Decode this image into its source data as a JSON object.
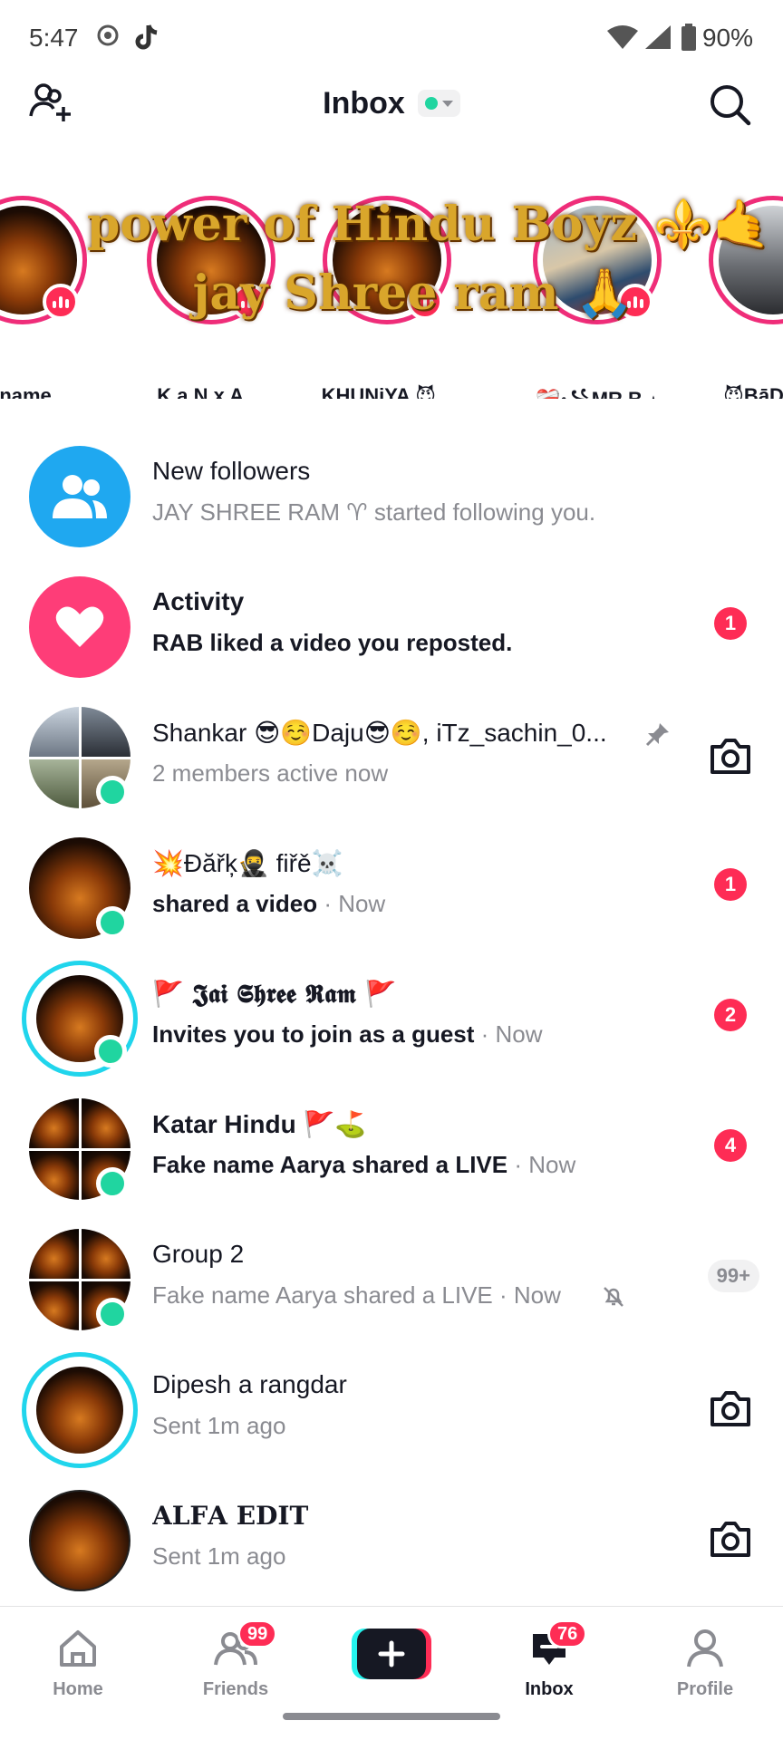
{
  "status_bar": {
    "time": "5:47",
    "battery": "90%"
  },
  "header": {
    "title": "Inbox"
  },
  "stories": [
    {
      "name": "ke name ..."
    },
    {
      "name": "K a N x A ..."
    },
    {
      "name": "KHUNiYA 😈..."
    },
    {
      "name": "❤️‍🩹꧁MR.B.٭"
    },
    {
      "name": "😈BāD"
    }
  ],
  "story_overlay": {
    "line1": "power of Hindu Boyz ⚜️🤙",
    "line2": "jay Shree ram 🙏"
  },
  "rows": [
    {
      "title": "New followers",
      "subtitle": "JAY SHREE RAM ♈ started following you."
    },
    {
      "title": "Activity",
      "subtitle": "RAB liked a video you reposted.",
      "badge": "1"
    },
    {
      "title": "Shankar 😎☺️Daju😎☺️, iTz_sachin_0...",
      "subtitle": "2 members active now"
    },
    {
      "title": "💥Đăřķ🥷 fiřě☠️",
      "subtitle": "shared a video",
      "time": "· Now",
      "badge": "1"
    },
    {
      "title": "🚩 𝕵𝖆𝖎 𝕾𝖍𝖗𝖊𝖊 𝕽𝖆𝖒 🚩",
      "subtitle": "Invites you to join as a guest",
      "time": "· Now",
      "badge": "2"
    },
    {
      "title": "Katar Hindu 🚩⛳",
      "subtitle": "Fake name Aarya shared a LIVE",
      "time": "· Now",
      "badge": "4"
    },
    {
      "title": "Group 2",
      "subtitle": "Fake name Aarya shared a LIVE · Now",
      "badge": "99+"
    },
    {
      "title": "Dipesh a rangdar",
      "subtitle": "Sent 1m ago"
    },
    {
      "title": "𝐀𝐋𝐅𝐀 𝐄𝐃𝐈𝐓",
      "subtitle": "Sent 1m ago"
    }
  ],
  "bottom_nav": {
    "home": "Home",
    "friends": "Friends",
    "friends_badge": "99",
    "inbox": "Inbox",
    "inbox_badge": "76",
    "profile": "Profile"
  },
  "colors": {
    "accent": "#fe2c55",
    "online": "#20d5a0",
    "followers_blue": "#1fa8f0",
    "activity_pink": "#fe3d78",
    "story_ring": "#ef2d79"
  },
  "icons": {
    "status": [
      "settings-icon",
      "tiktok-icon",
      "wifi-icon",
      "signal-icon",
      "battery-icon"
    ],
    "header": [
      "add-friend-icon",
      "search-icon"
    ],
    "rows": [
      "followers-icon",
      "heart-icon",
      "pin-icon",
      "camera-icon",
      "mute-bell-icon"
    ],
    "nav": [
      "home-icon",
      "friends-icon",
      "plus-icon",
      "inbox-icon",
      "profile-icon"
    ]
  }
}
